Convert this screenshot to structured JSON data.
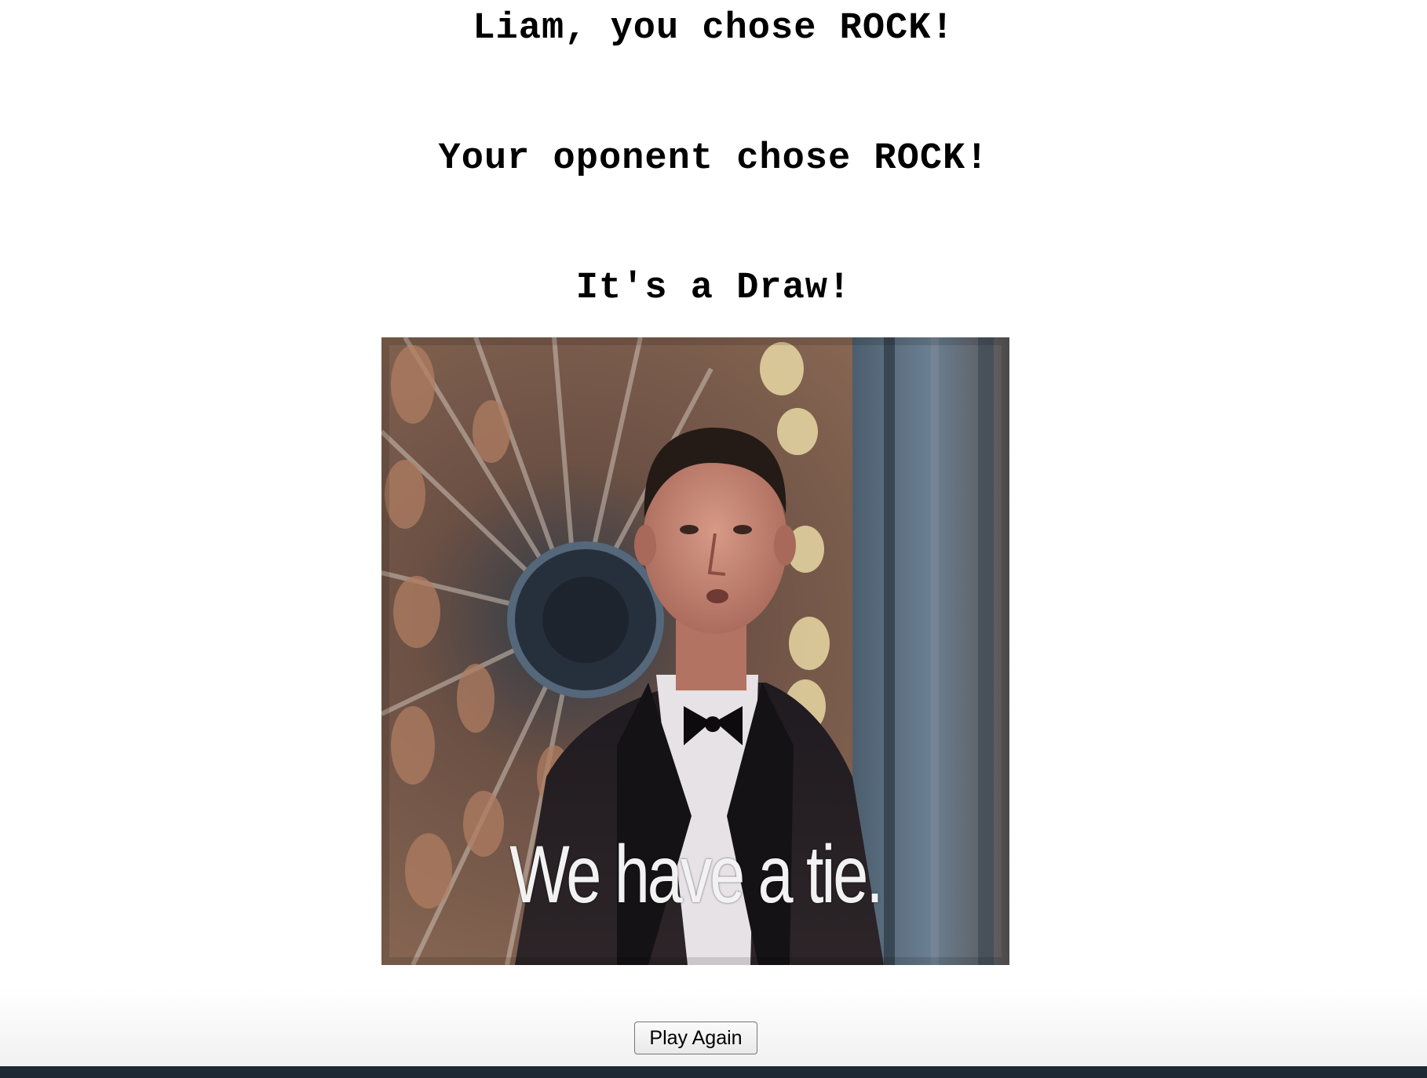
{
  "result_screen": {
    "user_choice_line": "Liam, you chose ROCK!",
    "opponent_choice_line": "Your oponent chose ROCK!",
    "outcome_line": "It's a Draw!"
  },
  "reaction_gif": {
    "caption": "We have a tie."
  },
  "actions": {
    "play_again_label": "Play Again"
  },
  "colors": {
    "background": "#ffffff",
    "text": "#000000",
    "footer_strip": "#1d2a36"
  }
}
